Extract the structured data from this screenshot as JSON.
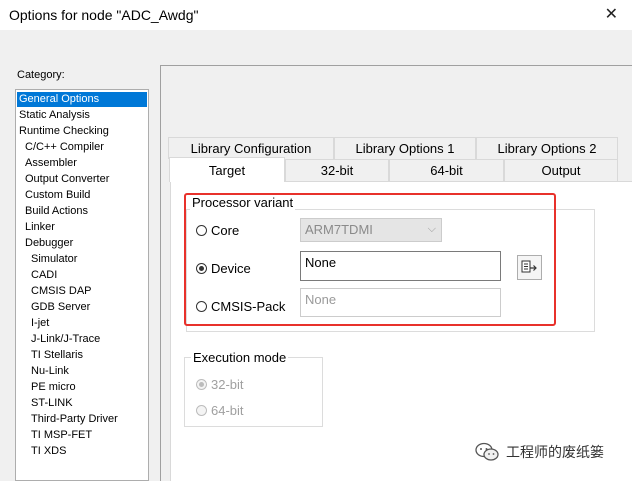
{
  "window": {
    "title": "Options for node \"ADC_Awdg\"",
    "close_glyph": "✕"
  },
  "category": {
    "label": "Category:",
    "items": [
      "General Options",
      "Static Analysis",
      "Runtime Checking",
      "C/C++ Compiler",
      "Assembler",
      "Output Converter",
      "Custom Build",
      "Build Actions",
      "Linker",
      "Debugger",
      "Simulator",
      "CADI",
      "CMSIS DAP",
      "GDB Server",
      "I-jet",
      "J-Link/J-Trace",
      "TI Stellaris",
      "Nu-Link",
      "PE micro",
      "ST-LINK",
      "Third-Party Driver",
      "TI MSP-FET",
      "TI XDS"
    ],
    "selected": "General Options"
  },
  "tabs": {
    "row1": [
      "Library Configuration",
      "Library Options 1",
      "Library Options 2"
    ],
    "row2": [
      "Target",
      "32-bit",
      "64-bit",
      "Output"
    ],
    "active": "Target"
  },
  "processor_variant": {
    "title": "Processor variant",
    "core_label": "Core",
    "core_value": "ARM7TDMI",
    "device_label": "Device",
    "device_value": "None",
    "cmsis_label": "CMSIS-Pack",
    "cmsis_value": "None",
    "selected": "Device"
  },
  "execution_mode": {
    "title": "Execution mode",
    "opt32": "32-bit",
    "opt64": "64-bit",
    "selected": "32-bit"
  },
  "colors": {
    "highlight": "#e8312b",
    "selection": "#0078d7"
  },
  "watermark": {
    "text": "工程师的废纸篓",
    "icon": "wechat-icon"
  }
}
